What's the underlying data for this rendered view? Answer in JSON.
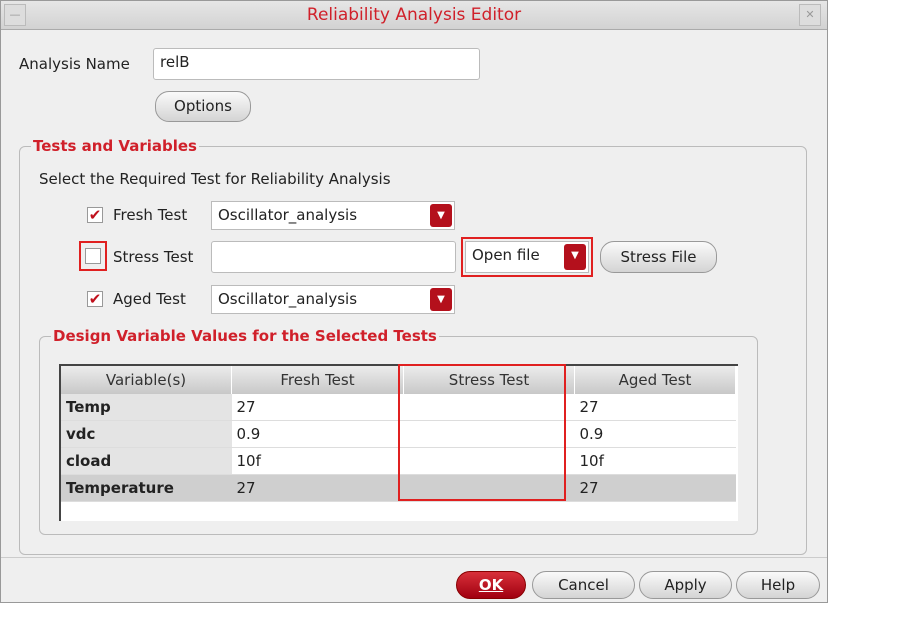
{
  "window": {
    "title": "Reliability Analysis Editor"
  },
  "analysis": {
    "label": "Analysis Name",
    "value": "relB",
    "options_label": "Options"
  },
  "tests": {
    "legend": "Tests and Variables",
    "instruction": "Select the Required Test for Reliability Analysis",
    "fresh": {
      "label": "Fresh Test",
      "checked": true,
      "value": "Oscillator_analysis"
    },
    "stress": {
      "label": "Stress Test",
      "checked": false,
      "value": "",
      "mode": "Open file",
      "file_button": "Stress File"
    },
    "aged": {
      "label": "Aged Test",
      "checked": true,
      "value": "Oscillator_analysis"
    }
  },
  "design": {
    "legend": "Design Variable Values for the Selected Tests",
    "columns": [
      "Variable(s)",
      "Fresh Test",
      "Stress Test",
      "Aged Test"
    ],
    "rows": [
      [
        "Temp",
        "27",
        "",
        "27"
      ],
      [
        "vdc",
        "0.9",
        "",
        "0.9"
      ],
      [
        "cload",
        "10f",
        "",
        "10f"
      ],
      [
        "Temperature",
        "27",
        "",
        "27"
      ]
    ]
  },
  "buttons": {
    "ok": "OK",
    "cancel": "Cancel",
    "apply": "Apply",
    "help": "Help"
  },
  "colors": {
    "accent": "#d0202a",
    "highlight": "#e02020"
  }
}
